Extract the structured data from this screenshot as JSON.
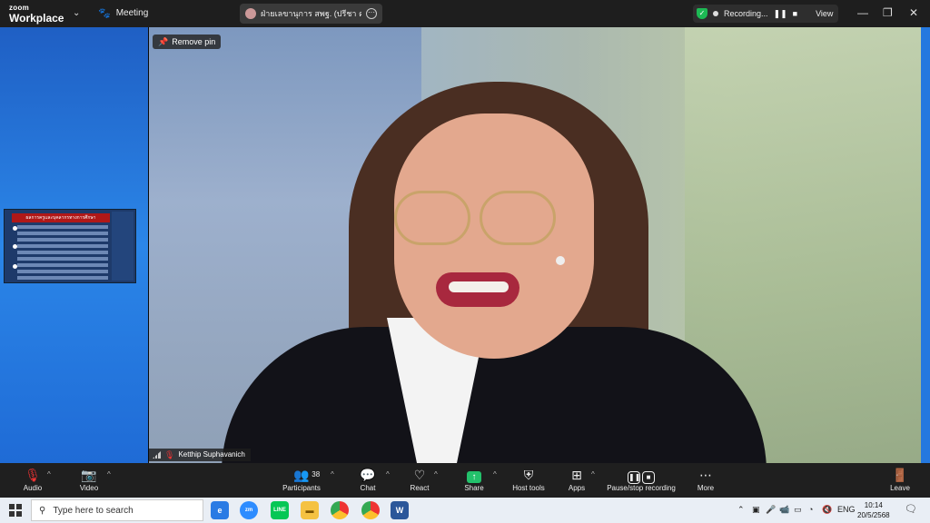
{
  "app": {
    "logo_line1": "zoom",
    "logo_line2": "Workplace",
    "meeting_label": "Meeting"
  },
  "speaker_pill": {
    "text": "ฝ่ายเลขานุการ สพฐ. (ปรีชา  คุณชาย )"
  },
  "recording": {
    "status": "Recording...",
    "view_label": "View"
  },
  "video": {
    "remove_pin": "Remove pin",
    "participant_name": "Ketthip Suphavanich"
  },
  "thumbnail": {
    "heading": "ผลการครูและบุคลากรทางการศึกษา"
  },
  "toolbar": {
    "audio": "Audio",
    "video": "Video",
    "participants": "Participants",
    "participants_count": "38",
    "chat": "Chat",
    "react": "React",
    "share": "Share",
    "host_tools": "Host tools",
    "apps": "Apps",
    "pause_stop": "Pause/stop recording",
    "more": "More",
    "leave": "Leave"
  },
  "taskbar": {
    "search_placeholder": "Type here to search",
    "language": "ENG",
    "time": "10:14",
    "date": "20/5/2568"
  },
  "colors": {
    "accent_blue": "#2478df",
    "share_green": "#23c16b",
    "leave_red": "#e33333",
    "shield_green": "#1db954"
  }
}
